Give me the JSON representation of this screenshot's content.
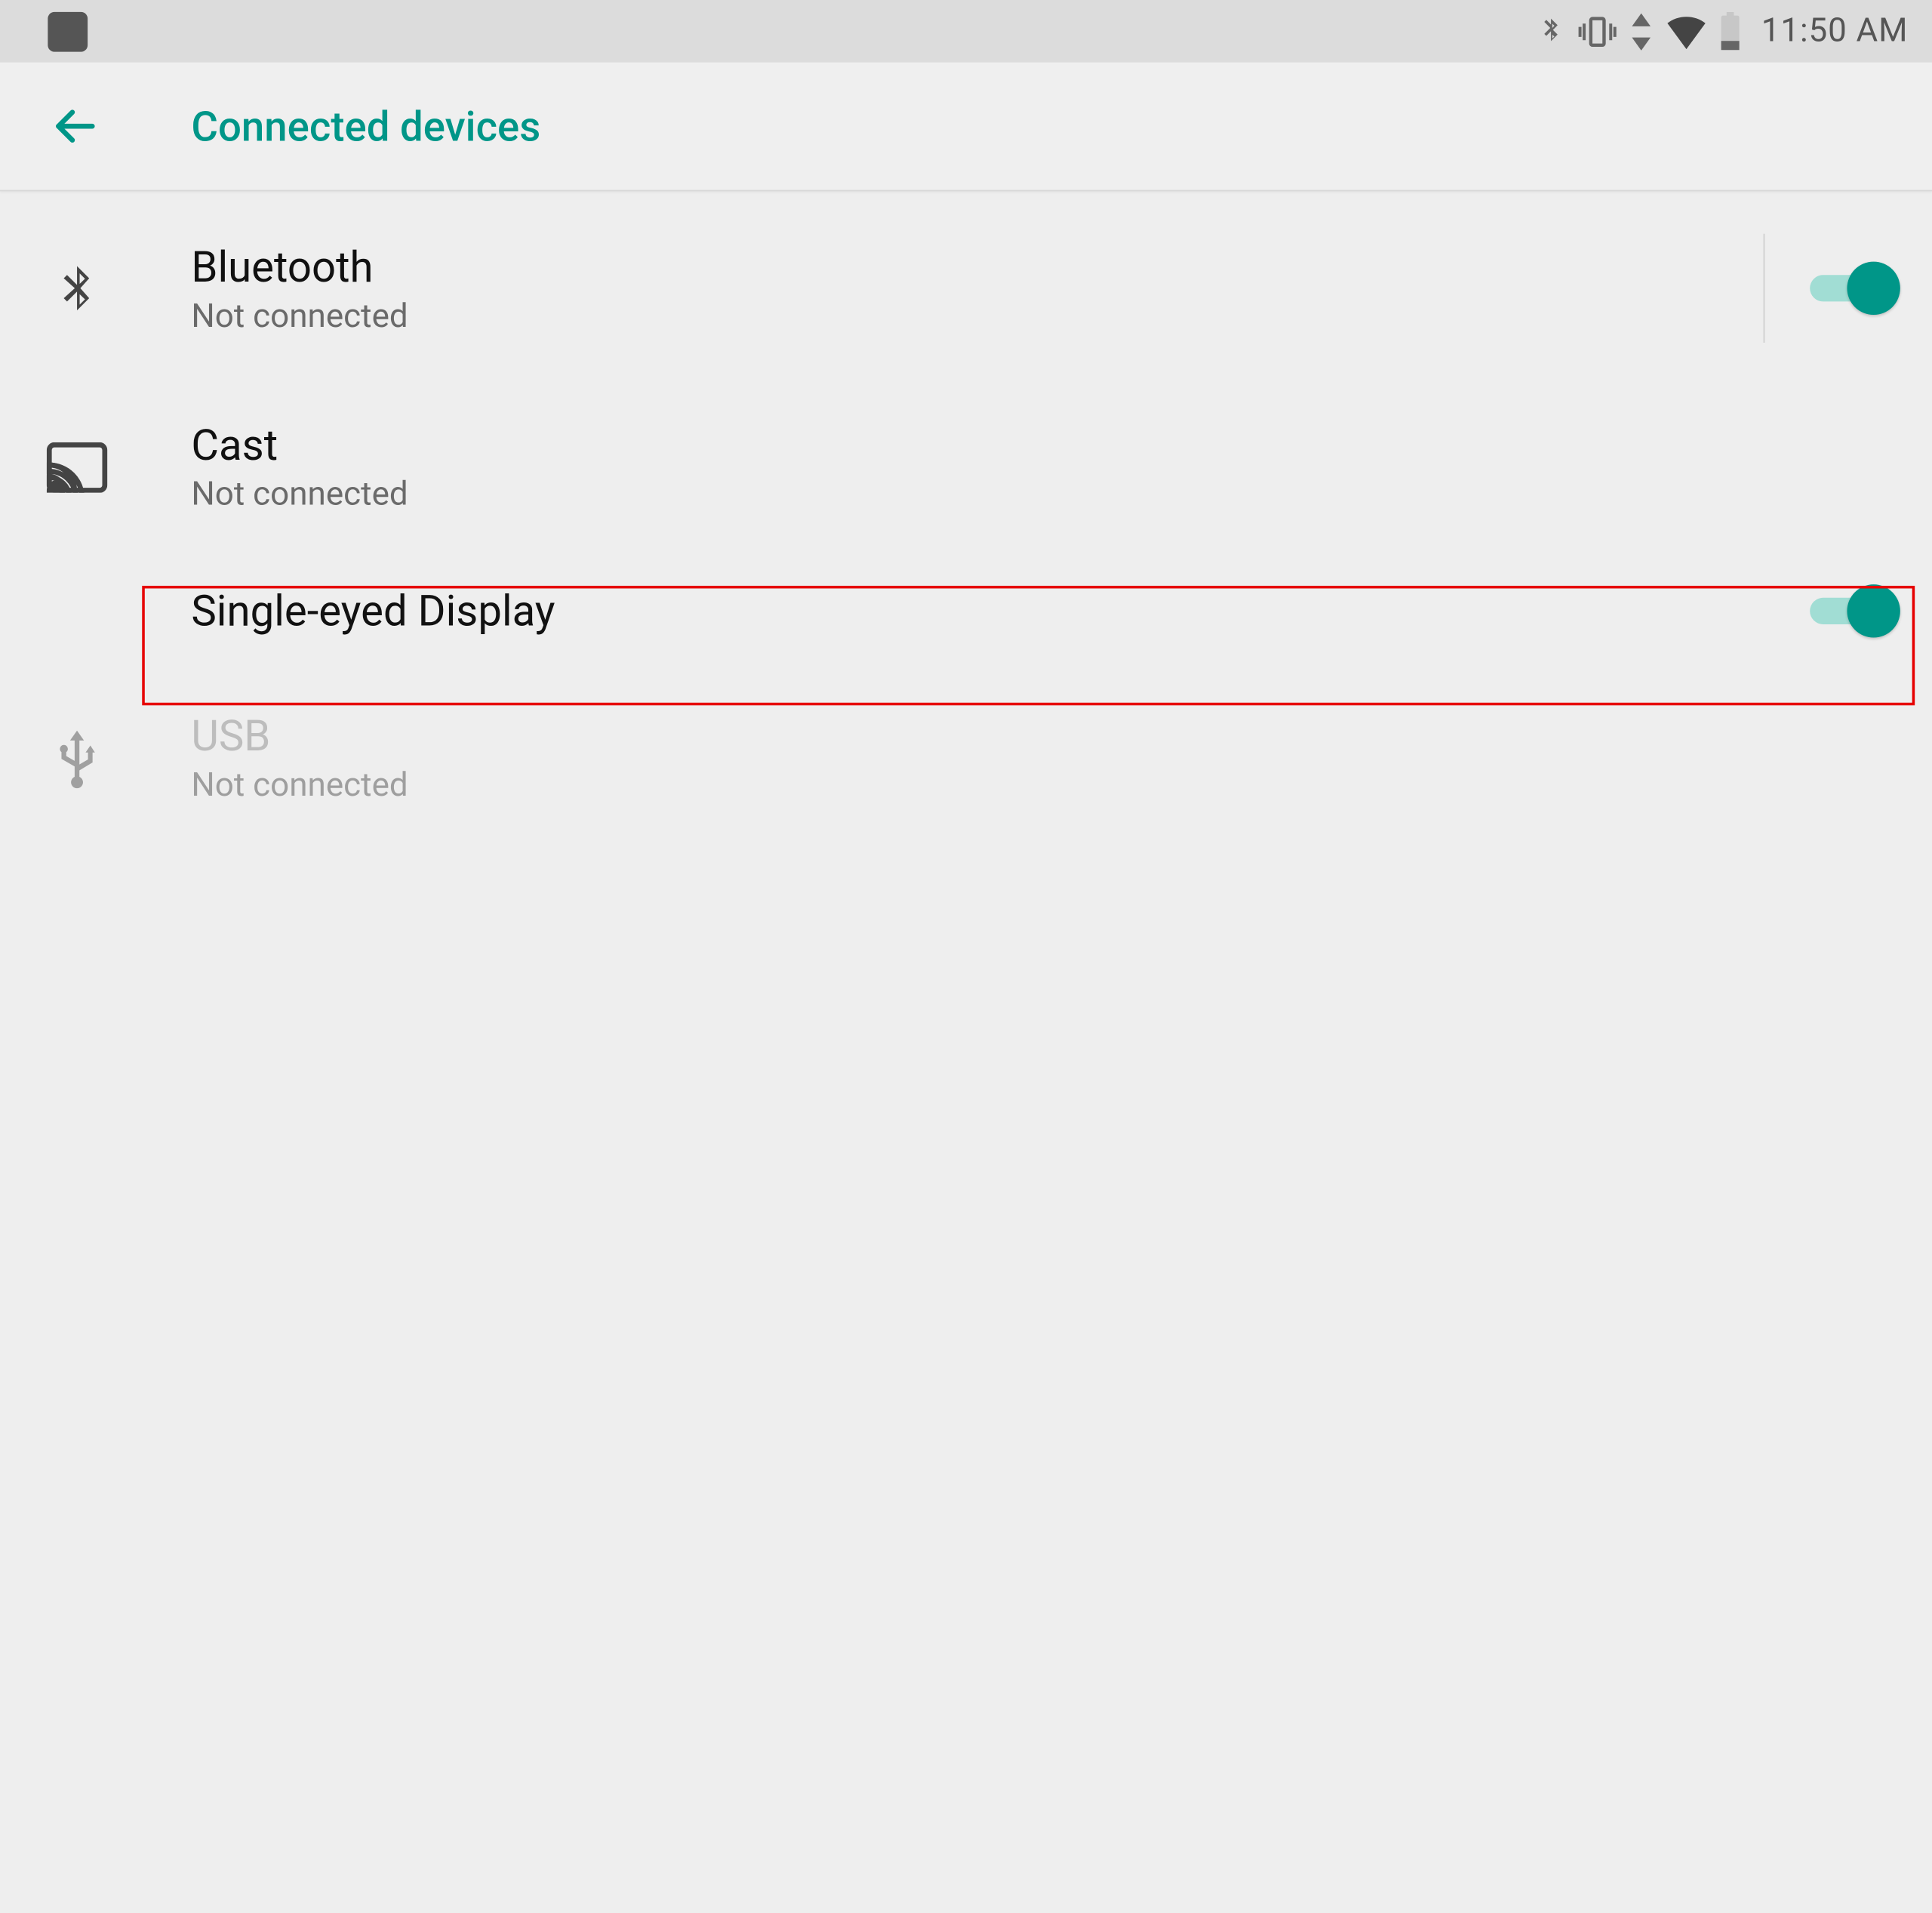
{
  "status_bar": {
    "time": "11:50 AM"
  },
  "header": {
    "title": "Connected devices"
  },
  "items": {
    "bluetooth": {
      "title": "Bluetooth",
      "sub": "Not connected",
      "toggle_on": true
    },
    "cast": {
      "title": "Cast",
      "sub": "Not connected"
    },
    "single_eyed": {
      "title": "Single-eyed Display",
      "toggle_on": true
    },
    "usb": {
      "title": "USB",
      "sub": "Not connected"
    }
  },
  "colors": {
    "accent": "#009688",
    "highlight_border": "#e60000"
  }
}
